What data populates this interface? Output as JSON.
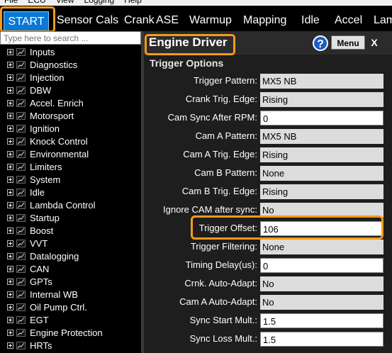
{
  "menubar": [
    "File",
    "ECU",
    "View",
    "Logging",
    "Help"
  ],
  "tabs": [
    "START",
    "Sensor Cals",
    "Crank",
    "ASE",
    "Warmup",
    "Mapping",
    "Idle",
    "Accel",
    "Lam"
  ],
  "search": {
    "placeholder": "Type here to search ..."
  },
  "tree": [
    "Inputs",
    "Diagnostics",
    "Injection",
    "DBW",
    "Accel. Enrich",
    "Motorsport",
    "Ignition",
    "Knock Control",
    "Environmental",
    "Limiters",
    "System",
    "Idle",
    "Lambda Control",
    "Startup",
    "Boost",
    "VVT",
    "Datalogging",
    "CAN",
    "GPTs",
    "Internal WB",
    "Oil Pump Ctrl.",
    "EGT",
    "Engine Protection",
    "HRTs"
  ],
  "panel": {
    "title": "Engine Driver",
    "help": "?",
    "menu_label": "Menu",
    "close_label": "X",
    "section": "Trigger Options",
    "fields": [
      {
        "label": "Trigger Pattern:",
        "value": "MX5 NB",
        "kind": "select"
      },
      {
        "label": "Crank Trig. Edge:",
        "value": "Rising",
        "kind": "select"
      },
      {
        "label": "Cam Sync After RPM:",
        "value": "0",
        "kind": "text"
      },
      {
        "label": "Cam A Pattern:",
        "value": "MX5 NB",
        "kind": "select"
      },
      {
        "label": "Cam A Trig. Edge:",
        "value": "Rising",
        "kind": "select"
      },
      {
        "label": "Cam B Pattern:",
        "value": "None",
        "kind": "select"
      },
      {
        "label": "Cam B Trig. Edge:",
        "value": "Rising",
        "kind": "select"
      },
      {
        "label": "Ignore CAM after sync:",
        "value": "No",
        "kind": "select"
      },
      {
        "label": "Trigger Offset:",
        "value": "106",
        "kind": "text"
      },
      {
        "label": "Trigger Filtering:",
        "value": "None",
        "kind": "select"
      },
      {
        "label": "Timing Delay(us):",
        "value": "0",
        "kind": "text"
      },
      {
        "label": "Crnk. Auto-Adapt:",
        "value": "No",
        "kind": "select"
      },
      {
        "label": "Cam A Auto-Adapt:",
        "value": "No",
        "kind": "select"
      },
      {
        "label": "Sync Start Mult.:",
        "value": "1.5",
        "kind": "text"
      },
      {
        "label": "Sync Loss Mult.:",
        "value": "1.5",
        "kind": "text"
      }
    ]
  },
  "colors": {
    "accent_highlight": "#f39a1c",
    "start_tab": "#0a78d7"
  }
}
